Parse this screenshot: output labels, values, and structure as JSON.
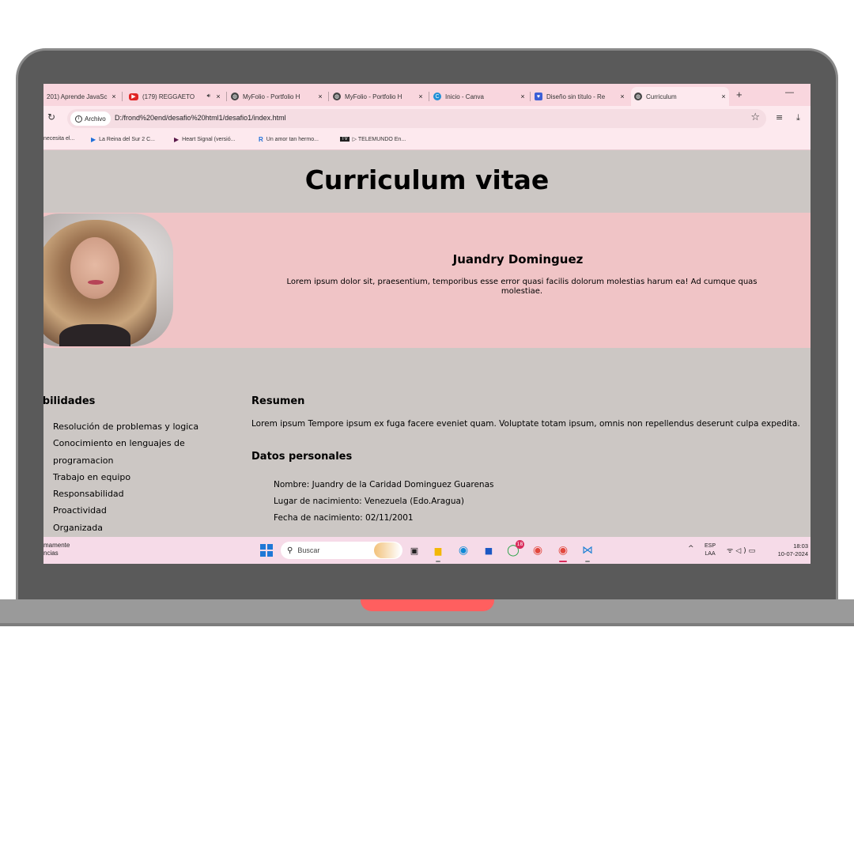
{
  "browser": {
    "tabs": [
      {
        "title": "201) Aprende JavaSc",
        "icon": "youtube-icon"
      },
      {
        "title": "(179) REGGAETO",
        "icon": "youtube-icon"
      },
      {
        "title": "MyFolio - Portfolio H",
        "icon": "globe-icon"
      },
      {
        "title": "MyFolio - Portfolio H",
        "icon": "globe-icon"
      },
      {
        "title": "Inicio - Canva",
        "icon": "canva-icon"
      },
      {
        "title": "Diseño sin título - Re",
        "icon": "chat-icon"
      },
      {
        "title": "Curriculum",
        "icon": "globe-icon"
      }
    ],
    "close_glyph": "×",
    "new_tab": "+",
    "minimize": "—",
    "site_chip": "Archivo",
    "url": "D:/frond%20end/desafio%20html1/desafio1/index.html",
    "bookmarks": [
      {
        "label": "necesita el...",
        "icon": "page-icon"
      },
      {
        "label": "La Reina del Sur 2 C...",
        "icon": "play-icon"
      },
      {
        "label": "Heart Signal (versió...",
        "icon": "play-icon"
      },
      {
        "label": "Un amor tan hermo...",
        "icon": "r-icon"
      },
      {
        "label": "▷ TELEMUNDO En...",
        "icon": "tv-icon"
      }
    ]
  },
  "cv": {
    "title": "Curriculum vitae",
    "name": "Juandry Dominguez",
    "intro": "Lorem ipsum dolor sit, praesentium, temporibus esse error quasi facilis dolorum molestias harum ea! Ad cumque quas molestiae.",
    "skills_heading": "abilidades",
    "skills": [
      "Resolución de problemas y logica",
      "Conocimiento en lenguajes de programacion",
      "Trabajo en equipo",
      "Responsabilidad",
      "Proactividad",
      "Organizada"
    ],
    "resumen_heading": "Resumen",
    "resumen_text": "Lorem ipsum Tempore ipsum ex fuga facere eveniet quam. Voluptate totam ipsum, omnis non repellendus deserunt culpa expedita.",
    "datos_heading": "Datos personales",
    "datos": [
      "Nombre: Juandry de la Caridad Dominguez Guarenas",
      "Lugar de nacimiento: Venezuela (Edo.Aragua)",
      "Fecha de nacimiento: 02/11/2001"
    ]
  },
  "taskbar": {
    "weather_line1": "mamente",
    "weather_line2": "ncias",
    "search_placeholder": "Buscar",
    "whatsapp_badge": "18",
    "lang_line1": "ESP",
    "lang_line2": "LAA",
    "time": "18:03",
    "date": "10-07-2024"
  },
  "colors": {
    "tabbar": "#f9d6de",
    "page_bg": "#ccc7c4",
    "profile_bg": "#f0c4c6",
    "laptop_body": "#5a5a5a",
    "laptop_notch": "#ff5f5f"
  }
}
